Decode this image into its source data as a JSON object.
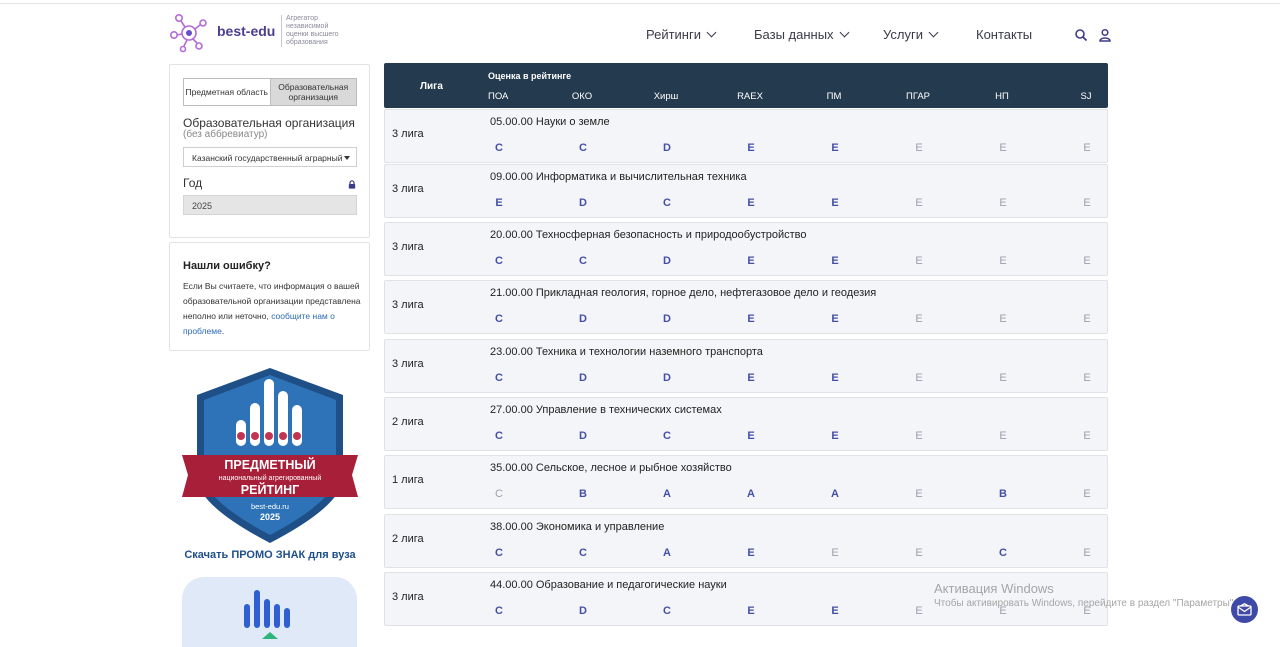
{
  "brand": {
    "name": "best-edu",
    "tagline": "Агрегатор независимой оценки высшего образования"
  },
  "nav": {
    "items": [
      {
        "label": "Рейтинги",
        "has_dropdown": true
      },
      {
        "label": "Базы данных",
        "has_dropdown": true
      },
      {
        "label": "Услуги",
        "has_dropdown": true
      },
      {
        "label": "Контакты",
        "has_dropdown": false
      }
    ],
    "icons": [
      "search-icon",
      "user-icon"
    ]
  },
  "filter": {
    "segments": [
      "Предметная область",
      "Образовательная организация"
    ],
    "active_segment": 1,
    "org_label": "Образовательная организация",
    "org_sub": "(без аббревиатур)",
    "org_value": "Казанский государственный аграрный",
    "year_label": "Год",
    "year_value": "2025",
    "year_locked": true
  },
  "error_box": {
    "title": "Нашли ошибку?",
    "text": "Если Вы считаете, что информация о вашей образовательной организации представлена неполно или неточно,",
    "link": "сообщите нам о проблеме",
    "after_link": "."
  },
  "badge": {
    "line1": "ПРЕДМЕТНЫЙ",
    "line2": "национальный агрегированный",
    "line3": "РЕЙТИНГ",
    "site": "best-edu.ru",
    "year": "2025",
    "promo_link": "Скачать ПРОМО ЗНАК для вуза"
  },
  "table": {
    "header_liga": "Лига",
    "header_score": "Оценка в рейтинге",
    "columns": [
      "ПОА",
      "ОКО",
      "Хирш",
      "RAEX",
      "ПМ",
      "ПГАР",
      "НП",
      "SJ"
    ],
    "rows": [
      {
        "liga": "3 лига",
        "title": "05.00.00 Науки о земле",
        "grades": [
          "C",
          "C",
          "D",
          "E",
          "E",
          "E",
          "E",
          "E"
        ],
        "muted": [
          false,
          false,
          false,
          false,
          false,
          true,
          true,
          true
        ]
      },
      {
        "liga": "3 лига",
        "title": "09.00.00 Информатика и вычислительная техника",
        "grades": [
          "E",
          "D",
          "C",
          "E",
          "E",
          "E",
          "E",
          "E"
        ],
        "muted": [
          false,
          false,
          false,
          false,
          false,
          true,
          true,
          true
        ]
      },
      {
        "liga": "3 лига",
        "title": "20.00.00 Техносферная безопасность и природообустройство",
        "grades": [
          "C",
          "C",
          "D",
          "E",
          "E",
          "E",
          "E",
          "E"
        ],
        "muted": [
          false,
          false,
          false,
          false,
          false,
          true,
          true,
          true
        ]
      },
      {
        "liga": "3 лига",
        "title": "21.00.00 Прикладная геология, горное дело, нефтегазовое дело и геодезия",
        "grades": [
          "C",
          "D",
          "D",
          "E",
          "E",
          "E",
          "E",
          "E"
        ],
        "muted": [
          false,
          false,
          false,
          false,
          false,
          true,
          true,
          true
        ]
      },
      {
        "liga": "3 лига",
        "title": "23.00.00 Техника и технологии наземного транспорта",
        "grades": [
          "C",
          "D",
          "D",
          "E",
          "E",
          "E",
          "E",
          "E"
        ],
        "muted": [
          false,
          false,
          false,
          false,
          false,
          true,
          true,
          true
        ]
      },
      {
        "liga": "2 лига",
        "title": "27.00.00 Управление в технических системах",
        "grades": [
          "C",
          "D",
          "C",
          "E",
          "E",
          "E",
          "E",
          "E"
        ],
        "muted": [
          false,
          false,
          false,
          false,
          false,
          true,
          true,
          true
        ]
      },
      {
        "liga": "1 лига",
        "title": "35.00.00 Сельское, лесное и рыбное хозяйство",
        "grades": [
          "C",
          "B",
          "A",
          "A",
          "A",
          "E",
          "B",
          "E"
        ],
        "muted": [
          true,
          false,
          false,
          false,
          false,
          true,
          false,
          true
        ]
      },
      {
        "liga": "2 лига",
        "title": "38.00.00 Экономика и управление",
        "grades": [
          "C",
          "C",
          "A",
          "E",
          "E",
          "E",
          "C",
          "E"
        ],
        "muted": [
          false,
          false,
          false,
          false,
          true,
          true,
          false,
          true
        ]
      },
      {
        "liga": "3 лига",
        "title": "44.00.00 Образование и педагогические науки",
        "grades": [
          "C",
          "D",
          "C",
          "E",
          "E",
          "E",
          "E",
          "E"
        ],
        "muted": [
          false,
          false,
          false,
          false,
          false,
          true,
          true,
          true
        ]
      }
    ]
  },
  "watermark": {
    "line1": "Активация Windows",
    "line2": "Чтобы активировать Windows, перейдите в раздел \"Параметры\"."
  },
  "colors": {
    "header_bg": "#243a4e",
    "grade": "#4450a8",
    "grade_muted": "#9b9fae",
    "row_bg": "#f4f5f8",
    "brand": "#4a3e8f"
  }
}
